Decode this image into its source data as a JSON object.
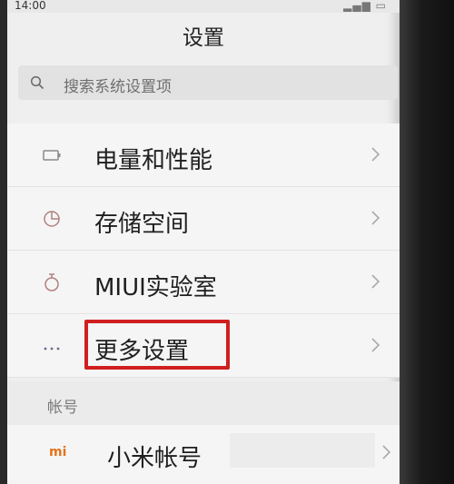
{
  "status_bar": {
    "time": "14:00"
  },
  "header": {
    "title": "设置"
  },
  "search": {
    "placeholder": "搜索系统设置项"
  },
  "settings": [
    {
      "label": "电量和性能",
      "icon": "battery-icon"
    },
    {
      "label": "存储空间",
      "icon": "storage-pie-icon"
    },
    {
      "label": "MIUI实验室",
      "icon": "flask-icon"
    },
    {
      "label": "更多设置",
      "icon": "more-dots-icon"
    }
  ],
  "account_section": {
    "header": "帐号",
    "item_label": "小米帐号",
    "logo_text": "mi",
    "logo_color": "#e2741f"
  },
  "annotation": {
    "highlight_color": "#d01f1f",
    "highlighted_item": "更多设置"
  }
}
